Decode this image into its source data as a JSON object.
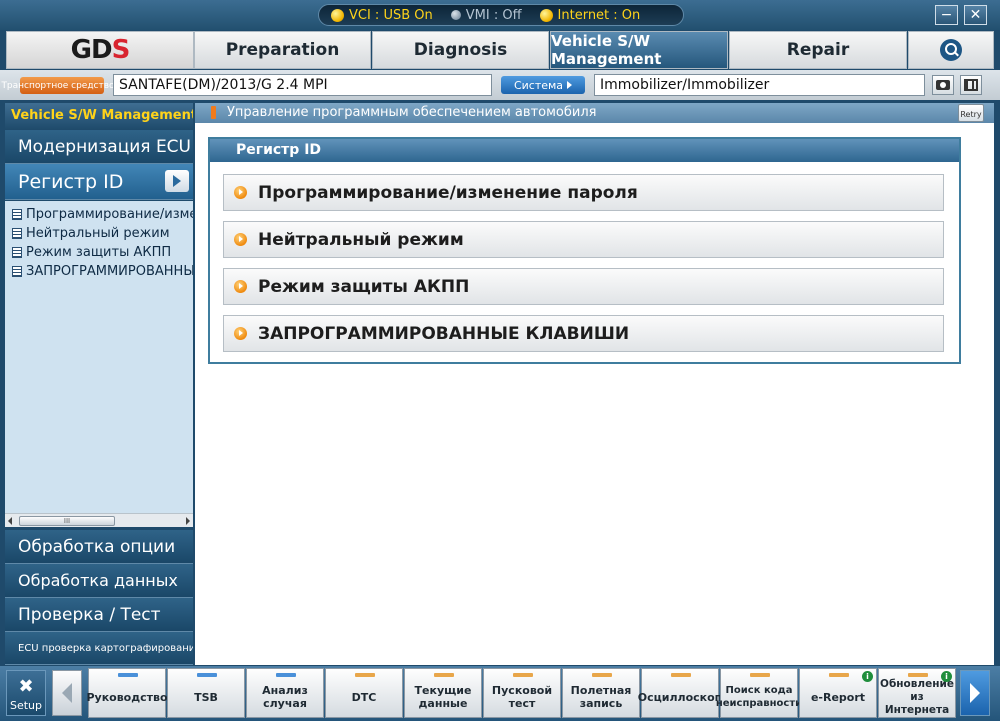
{
  "status": {
    "vci": "VCI : USB On",
    "vmi": "VMI : Off",
    "internet": "Internet : On"
  },
  "window": {
    "minimize": "−",
    "close": "✕"
  },
  "logo": {
    "part1": "GD",
    "part2": "S"
  },
  "nav": {
    "tabs": [
      "Preparation",
      "Diagnosis",
      "Vehicle S/W Management",
      "Repair"
    ],
    "active": "Vehicle S/W Management"
  },
  "vehicle_bar": {
    "vehicle_label": "Транспортное средство",
    "vehicle_value": "SANTAFE(DM)/2013/G 2.4 MPI",
    "system_label": "Система",
    "system_value": "Immobilizer/Immobilizer"
  },
  "sidebar": {
    "header": "Vehicle S/W Management",
    "items": [
      "Модернизация ECU",
      "Регистр ID"
    ],
    "tree": [
      "Программирование/изменение пароля",
      "Нейтральный режим",
      "Режим защиты АКПП",
      "ЗАПРОГРАММИРОВАННЫЕ КЛАВИШИ"
    ],
    "scroll_label": "III",
    "bottom_items": [
      "Обработка опции",
      "Обработка данных",
      "Проверка / Тест",
      "ECU проверка картографирования"
    ]
  },
  "main": {
    "breadcrumb": "Управление программным обеспечением автомобиля",
    "retry": "Retry",
    "panel_title": "Регистр ID",
    "options": [
      "Программирование/изменение пароля",
      "Нейтральный режим",
      "Режим защиты АКПП",
      "ЗАПРОГРАММИРОВАННЫЕ КЛАВИШИ"
    ]
  },
  "toolbar": {
    "setup": "Setup",
    "buttons": [
      {
        "label1": "Руководство",
        "label2": "",
        "color": "#4a90d9"
      },
      {
        "label1": "TSB",
        "label2": "",
        "color": "#4a90d9"
      },
      {
        "label1": "Анализ",
        "label2": "случая",
        "color": "#4a90d9"
      },
      {
        "label1": "DTC",
        "label2": "",
        "color": "#e8a64a"
      },
      {
        "label1": "Текущие",
        "label2": "данные",
        "color": "#e8a64a"
      },
      {
        "label1": "Пусковой",
        "label2": "тест",
        "color": "#e8a64a"
      },
      {
        "label1": "Полетная",
        "label2": "запись",
        "color": "#e8a64a"
      },
      {
        "label1": "Осциллоскоп",
        "label2": "",
        "color": "#e8a64a"
      },
      {
        "label1": "Поиск кода",
        "label2": "неисправности",
        "color": "#e8a64a"
      },
      {
        "label1": "e-Report",
        "label2": "",
        "color": "#e8a64a"
      },
      {
        "label1": "Обновление",
        "label2": "из Интернета",
        "color": "#e8a64a"
      }
    ]
  },
  "colors": {
    "accent": "#f07b1c",
    "status_on": "#ffd31a",
    "nav_active": "#25577c"
  }
}
